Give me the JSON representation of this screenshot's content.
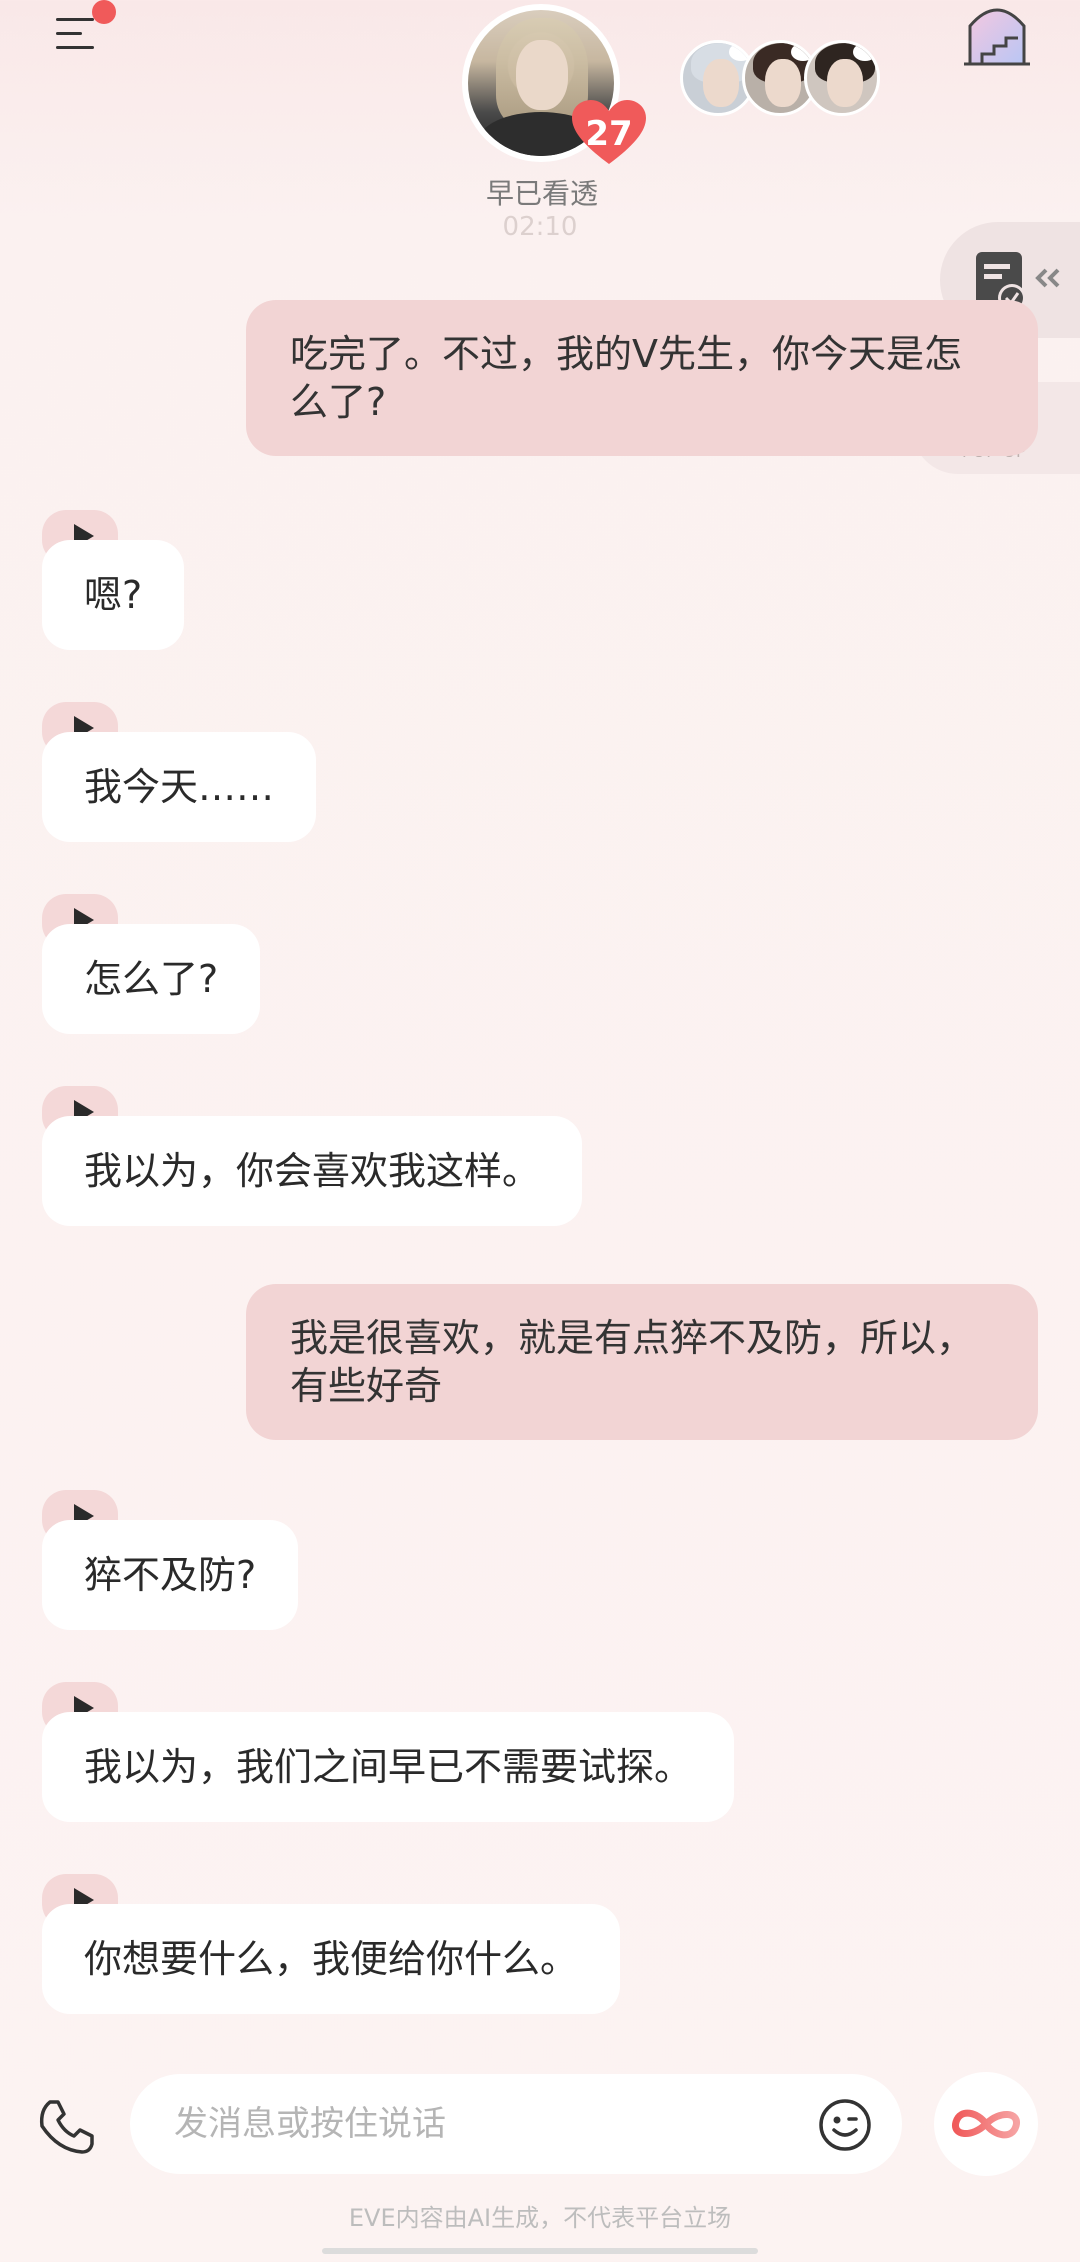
{
  "header": {
    "character_name": "早已看透",
    "faded_time": "02:10",
    "affinity": "27"
  },
  "side": {
    "popup_title": "资讯",
    "popup_sub": "POP-UP"
  },
  "messages": [
    {
      "role": "user",
      "text": "吃完了。不过，我的V先生，你今天是怎么了?"
    },
    {
      "role": "ai",
      "text": "嗯?"
    },
    {
      "role": "ai",
      "text": "我今天……"
    },
    {
      "role": "ai",
      "text": "怎么了?"
    },
    {
      "role": "ai",
      "text": "我以为，你会喜欢我这样。"
    },
    {
      "role": "user",
      "text": "我是很喜欢，就是有点猝不及防，所以，有些好奇"
    },
    {
      "role": "ai",
      "text": "猝不及防?"
    },
    {
      "role": "ai",
      "text": "我以为，我们之间早已不需要试探。"
    },
    {
      "role": "ai",
      "text": "你想要什么，我便给你什么。"
    }
  ],
  "input": {
    "placeholder": "发消息或按住说话"
  },
  "footer": {
    "disclaimer": "EVE内容由AI生成，不代表平台立场"
  },
  "colors": {
    "user_bubble": "#f2d4d4",
    "ai_bubble": "#ffffff",
    "accent": "#f05a5a"
  }
}
